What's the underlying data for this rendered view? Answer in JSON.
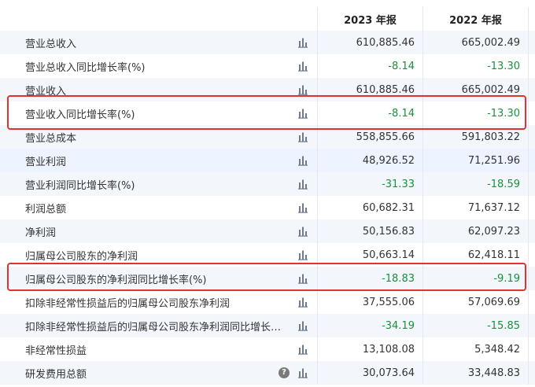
{
  "header": {
    "col1": "2023 年报",
    "col2": "2022 年报"
  },
  "rows": [
    {
      "label": "营业总收入",
      "v2023": "610,885.46",
      "v2022": "665,002.49"
    },
    {
      "label": "营业总收入同比增长率(%)",
      "v2023": "-8.14",
      "v2022": "-13.30"
    },
    {
      "label": "营业收入",
      "v2023": "610,885.46",
      "v2022": "665,002.49"
    },
    {
      "label": "营业收入同比增长率(%)",
      "v2023": "-8.14",
      "v2022": "-13.30"
    },
    {
      "label": "营业总成本",
      "v2023": "558,855.66",
      "v2022": "591,803.22"
    },
    {
      "label": "营业利润",
      "v2023": "48,926.52",
      "v2022": "71,251.96"
    },
    {
      "label": "营业利润同比增长率(%)",
      "v2023": "-31.33",
      "v2022": "-18.59"
    },
    {
      "label": "利润总额",
      "v2023": "60,682.31",
      "v2022": "71,637.12"
    },
    {
      "label": "净利润",
      "v2023": "50,156.83",
      "v2022": "62,097.23"
    },
    {
      "label": "归属母公司股东的净利润",
      "v2023": "50,663.14",
      "v2022": "62,418.11"
    },
    {
      "label": "归属母公司股东的净利润同比增长率(%)",
      "v2023": "-18.83",
      "v2022": "-9.19"
    },
    {
      "label": "扣除非经常性损益后的归属母公司股东净利润",
      "v2023": "37,555.06",
      "v2022": "57,069.69"
    },
    {
      "label": "扣除非经常性损益后的归属母公司股东净利润同比增长率(%)",
      "v2023": "-34.19",
      "v2022": "-15.85"
    },
    {
      "label": "非经常性损益",
      "v2023": "13,108.08",
      "v2022": "5,348.42"
    },
    {
      "label": "研发费用总额",
      "v2023": "30,073.64",
      "v2022": "33,448.83",
      "help_icon": "?"
    }
  ],
  "colors": {
    "negative": "#1a8f3c",
    "highlight_border": "#e0322f",
    "alt_row": "#f3f6fb"
  },
  "icons": {
    "row_action": "bar-chart-icon",
    "help": "question-circle-icon"
  }
}
